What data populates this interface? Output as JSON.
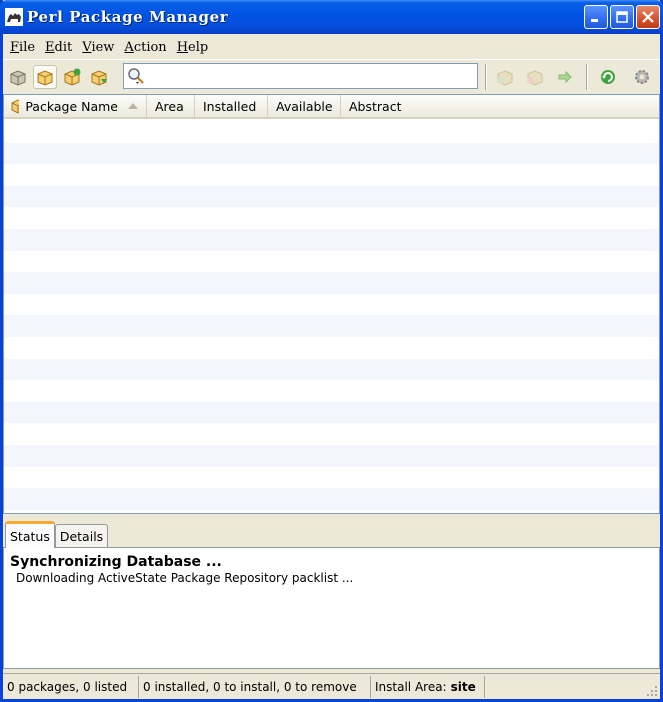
{
  "window": {
    "title": "Perl Package Manager"
  },
  "menu": [
    {
      "label": "File",
      "accel": "F",
      "rest": "ile"
    },
    {
      "label": "Edit",
      "accel": "E",
      "rest": "dit"
    },
    {
      "label": "View",
      "accel": "V",
      "rest": "iew"
    },
    {
      "label": "Action",
      "accel": "A",
      "rest": "ction"
    },
    {
      "label": "Help",
      "accel": "H",
      "rest": "elp"
    }
  ],
  "toolbar": {
    "search": {
      "value": "",
      "placeholder": ""
    }
  },
  "list": {
    "columns": [
      "Package Name",
      "Area",
      "Installed",
      "Available",
      "Abstract"
    ]
  },
  "tabs": [
    "Status",
    "Details"
  ],
  "status": {
    "title": "Synchronizing Database ...",
    "detail": "Downloading ActiveState Package Repository packlist ..."
  },
  "statusbar": {
    "packages": "0 packages, 0 listed",
    "installed": "0 installed, 0 to install, 0 to remove",
    "area_label": "Install Area:",
    "area_value": "site"
  },
  "colors": {
    "titlebar": "#0054e3",
    "tab_accent": "#f7a934",
    "row_alt": "#f3f6fc"
  }
}
